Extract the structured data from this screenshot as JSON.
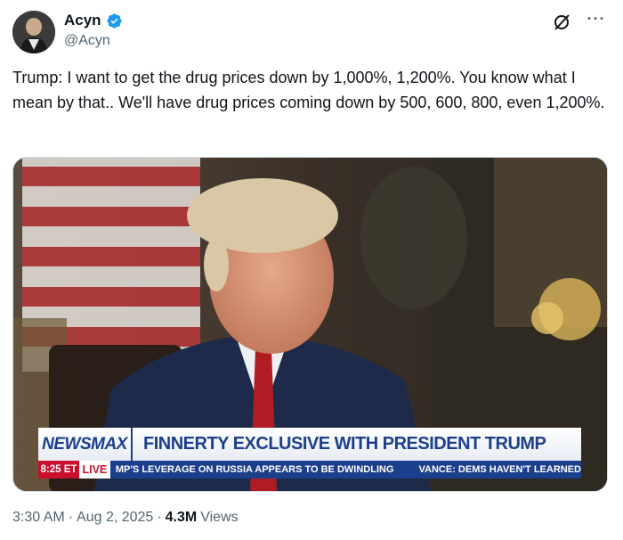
{
  "author": {
    "display_name": "Acyn",
    "handle": "@Acyn",
    "verified": true,
    "avatar_icon": "user-avatar"
  },
  "actions": {
    "grok_icon": "grok-icon",
    "more_label": "···"
  },
  "tweet": {
    "text": "Trump: I want to get the drug prices down by 1,000%, 1,200%. You know what I mean by that.. We'll have drug prices coming down by 500, 600, 800, even 1,200%."
  },
  "media": {
    "network": "NEWSMAX",
    "headline": "FINNERTY EXCLUSIVE WITH PRESIDENT TRUMP",
    "time": "8:25 ET",
    "live": "LIVE",
    "ticker_1": "MP'S LEVERAGE ON RUSSIA APPEARS TO BE DWINDLING",
    "ticker_2": "VANCE: DEMS HAVEN'T LEARNED"
  },
  "meta": {
    "time": "3:30 AM",
    "date": "Aug 2, 2025",
    "separator": "·",
    "views_count": "4.3M",
    "views_label": "Views"
  },
  "colors": {
    "verified_blue": "#1d9bf0",
    "secondary_text": "#536471",
    "newsmax_blue": "#1c3f8c",
    "newsmax_red": "#c8102e"
  }
}
